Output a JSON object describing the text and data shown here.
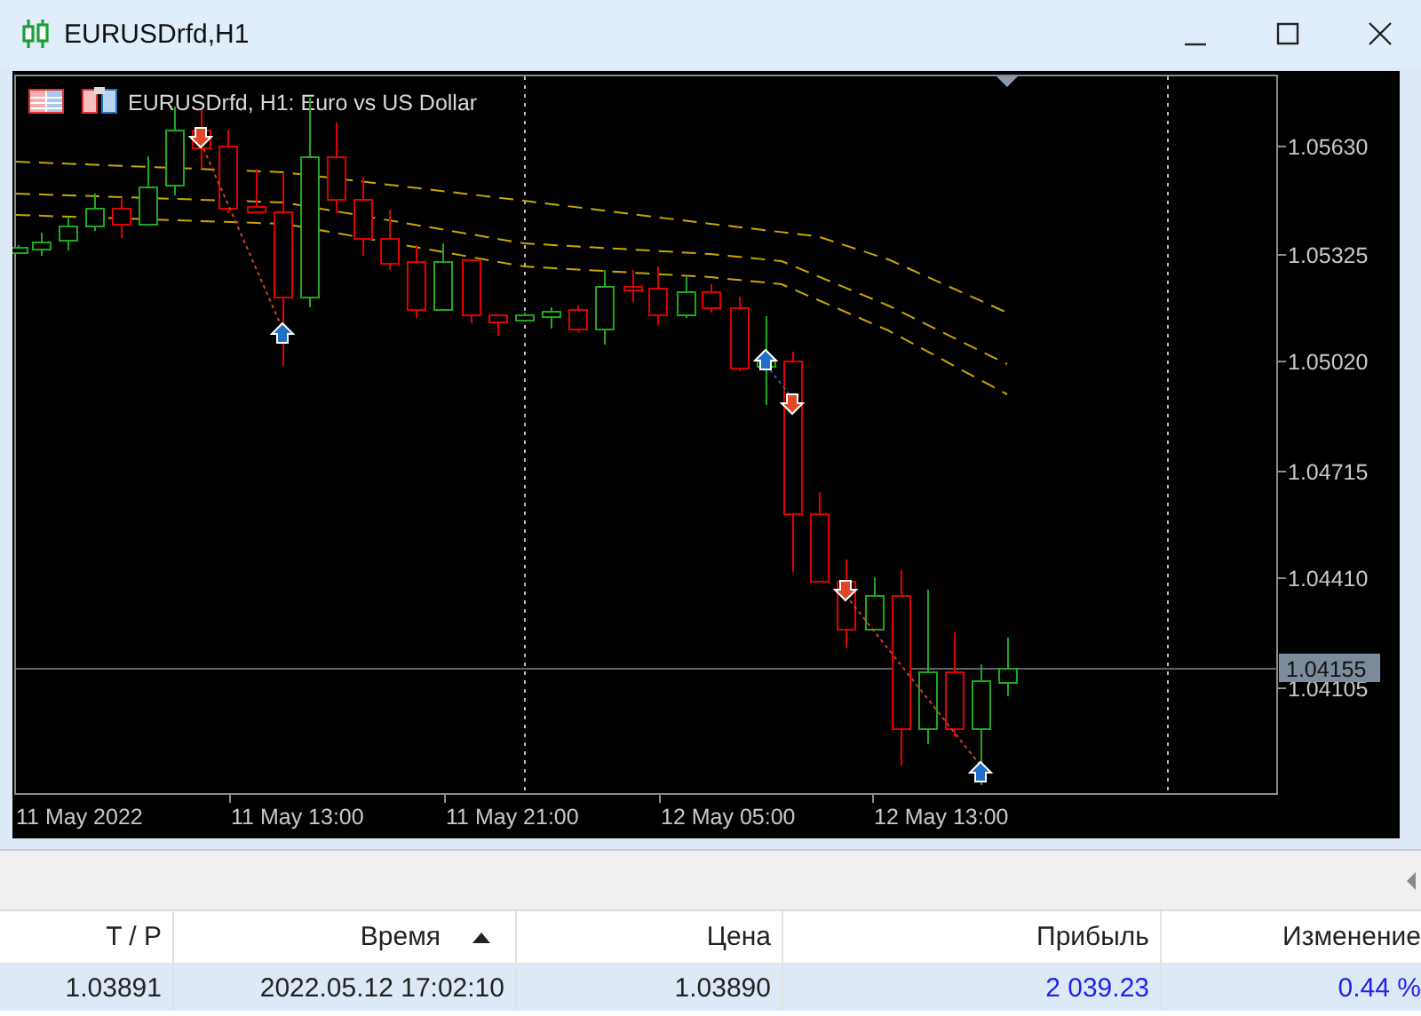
{
  "window": {
    "title": "EURUSDrfd,H1"
  },
  "chart": {
    "legend": "EURUSDrfd, H1:  Euro vs US Dollar",
    "price_labels": [
      "1.05630",
      "1.05325",
      "1.05020",
      "1.04715",
      "1.04410",
      "1.04105"
    ],
    "current_price": "1.04155",
    "time_labels": [
      "11 May 2022",
      "11 May 13:00",
      "11 May 21:00",
      "12 May 05:00",
      "12 May 13:00"
    ]
  },
  "table": {
    "columns": [
      {
        "label": "T / P",
        "sorted": false,
        "kind": "plain"
      },
      {
        "label": "Время",
        "sorted": true,
        "kind": "plain"
      },
      {
        "label": "Цена",
        "sorted": false,
        "kind": "plain"
      },
      {
        "label": "Прибыль",
        "sorted": false,
        "kind": "profit"
      },
      {
        "label": "Изменение",
        "sorted": false,
        "kind": "profit"
      }
    ],
    "rows": [
      {
        "selected": true,
        "cells": [
          "1.03891",
          "2022.05.12 17:02:10",
          "1.03890",
          "2 039.23",
          "0.44 %"
        ]
      }
    ]
  }
}
